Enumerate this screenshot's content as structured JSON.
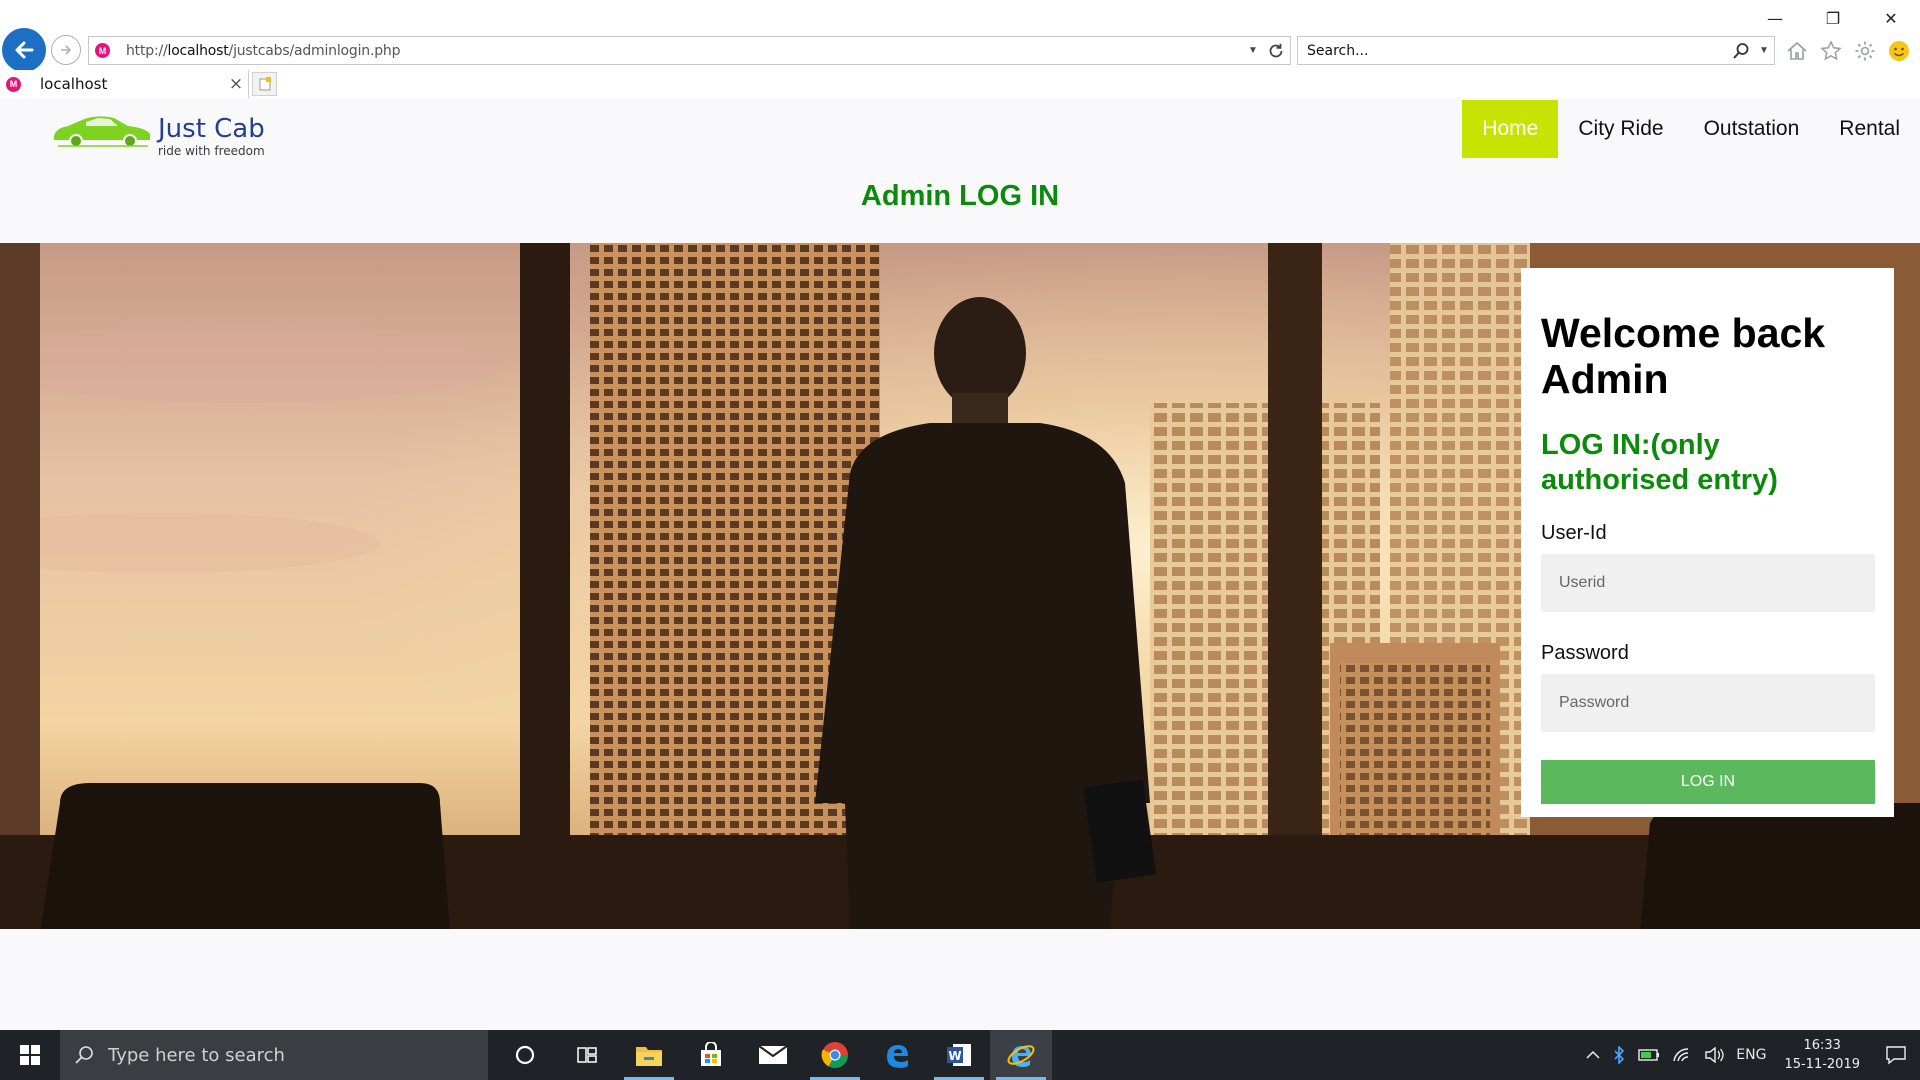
{
  "browser": {
    "url_prefix": "http://",
    "url_host": "localhost",
    "url_path": "/justcabs/adminlogin.php",
    "search_placeholder": "Search...",
    "tab_title": "localhost",
    "tab_close": "×",
    "minimize": "—",
    "restore": "❐",
    "close": "✕"
  },
  "site": {
    "brand_name": "Just Cab",
    "brand_tagline": "ride with freedom",
    "nav": [
      {
        "label": "Home",
        "active": true
      },
      {
        "label": "City Ride",
        "active": false
      },
      {
        "label": "Outstation",
        "active": false
      },
      {
        "label": "Rental",
        "active": false
      }
    ],
    "page_heading": "Admin LOG IN",
    "accent_color": "#c7e300",
    "heading_color": "#0b8a0b"
  },
  "login": {
    "welcome_line1": "Welcome back",
    "welcome_line2": "Admin",
    "subtitle_line1": "LOG IN:(only",
    "subtitle_line2": "authorised entry)",
    "userid_label": "User-Id",
    "userid_placeholder": "Userid",
    "password_label": "Password",
    "password_placeholder": "Password",
    "button_label": "LOG IN",
    "button_color": "#5cb85c"
  },
  "taskbar": {
    "search_placeholder": "Type here to search",
    "language": "ENG",
    "time": "16:33",
    "date": "15-11-2019",
    "apps": [
      "cortana-icon",
      "task-view-icon",
      "file-explorer-icon",
      "store-icon",
      "mail-icon",
      "chrome-icon",
      "edge-icon",
      "word-icon",
      "internet-explorer-icon"
    ]
  }
}
